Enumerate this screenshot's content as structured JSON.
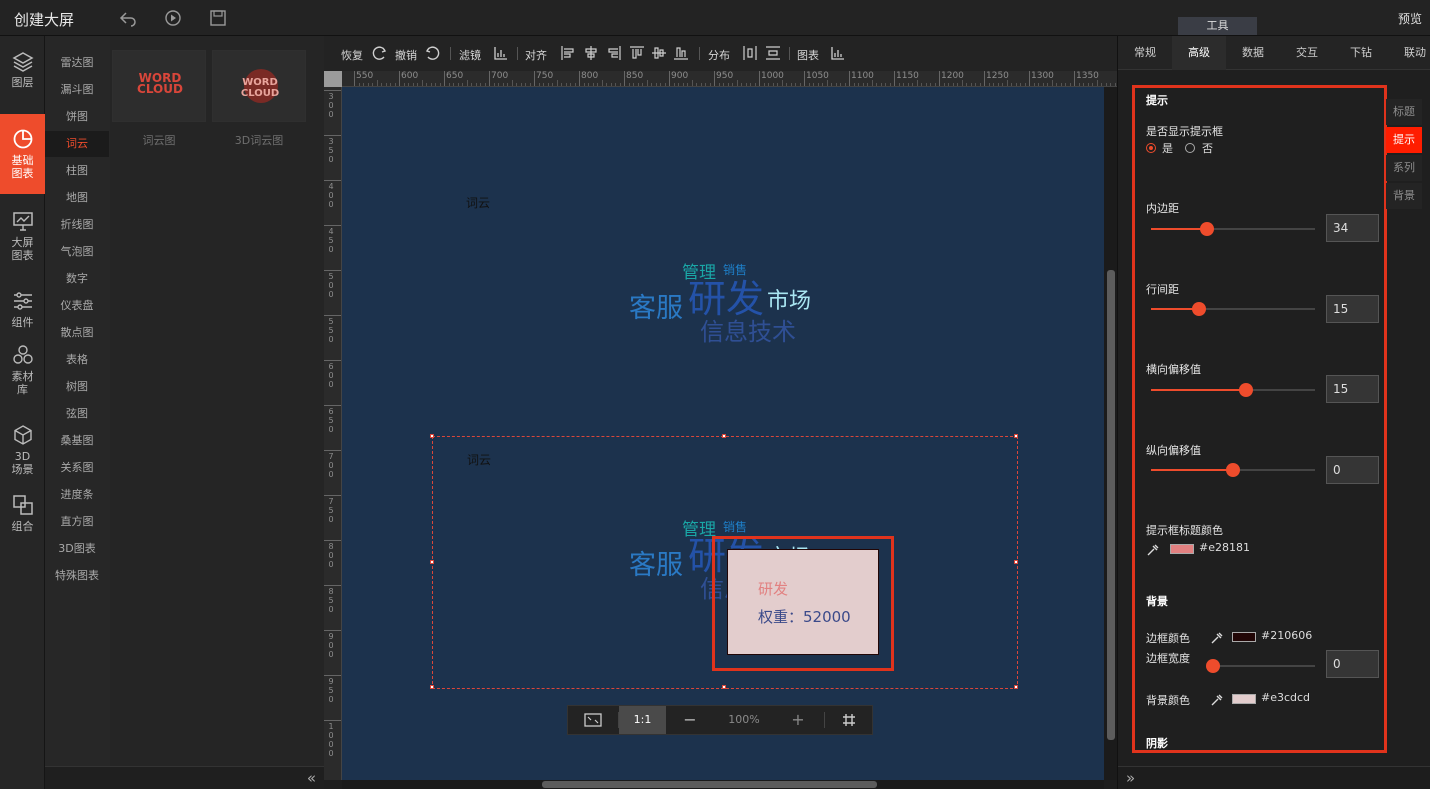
{
  "app": {
    "title": "创建大屏",
    "preview": "预览",
    "tools_tab": "工具"
  },
  "leftnav": [
    {
      "label1": "图层",
      "label2": "",
      "icon": "layers-icon"
    },
    {
      "label1": "基础",
      "label2": "图表",
      "icon": "pie-chart-icon",
      "active": true
    },
    {
      "label1": "大屏",
      "label2": "图表",
      "icon": "screen-chart-icon"
    },
    {
      "label1": "组件",
      "label2": "",
      "icon": "sliders-icon"
    },
    {
      "label1": "素材",
      "label2": "库",
      "icon": "hexagons-icon"
    },
    {
      "label1": "3D",
      "label2": "场景",
      "icon": "cube-icon"
    },
    {
      "label1": "组合",
      "label2": "",
      "icon": "group-icon"
    }
  ],
  "categories": [
    "雷达图",
    "漏斗图",
    "饼图",
    "词云",
    "柱图",
    "地图",
    "折线图",
    "气泡图",
    "数字",
    "仪表盘",
    "散点图",
    "表格",
    "树图",
    "弦图",
    "桑基图",
    "关系图",
    "进度条",
    "直方图",
    "3D图表",
    "特殊图表"
  ],
  "active_category": "词云",
  "thumbs": [
    {
      "label": "词云图",
      "logo_top": "WORD",
      "logo_bottom": "CLOUD"
    },
    {
      "label": "3D词云图",
      "logo_top": "WORD",
      "logo_bottom": "CLOUD"
    }
  ],
  "toolbar": {
    "redo": "恢复",
    "undo": "撤销",
    "filter": "滤镜",
    "align": "对齐",
    "distribute": "分布",
    "chart": "图表"
  },
  "ruler": {
    "top": [
      "550",
      "600",
      "650",
      "700",
      "750",
      "800",
      "850",
      "900",
      "950",
      "1000",
      "1050",
      "1100",
      "1150",
      "1200",
      "1250",
      "1300",
      "1350"
    ],
    "left": [
      "300",
      "350",
      "400",
      "450",
      "500",
      "550",
      "600",
      "650",
      "700",
      "750",
      "800",
      "850",
      "900",
      "950",
      "1000"
    ]
  },
  "canvas": {
    "chart1_title": "词云",
    "chart2_title": "词云",
    "words": [
      {
        "text": "管理",
        "color": "#1aa6a6"
      },
      {
        "text": "销售",
        "color": "#1e7fc8"
      },
      {
        "text": "客服",
        "color": "#2a79c4"
      },
      {
        "text": "研发",
        "color": "#2452a8"
      },
      {
        "text": "市场",
        "color": "#a9e6f2"
      },
      {
        "text": "信息技术",
        "color": "#2f4f94"
      }
    ],
    "tooltip": {
      "title": "研发",
      "body": "权重：52000"
    }
  },
  "zoom": {
    "fit": "fit-screen-icon",
    "one_to_one": "1:1",
    "minus": "−",
    "value": "100%",
    "plus": "+",
    "grid": "grid-icon"
  },
  "rpanel": {
    "tabs": [
      "常规",
      "高级",
      "数据",
      "交互",
      "下钻",
      "联动"
    ],
    "active_tab": "高级",
    "side_tabs": [
      "标题",
      "提示",
      "系列",
      "背景"
    ],
    "active_side": "提示",
    "section_tip": "提示",
    "show_tip_label": "是否显示提示框",
    "yes": "是",
    "no": "否",
    "padding_label": "内边距",
    "padding_value": "34",
    "line_gap_label": "行间距",
    "line_gap_value": "15",
    "h_offset_label": "横向偏移值",
    "h_offset_value": "15",
    "v_offset_label": "纵向偏移值",
    "v_offset_value": "0",
    "title_color_label": "提示框标题颜色",
    "title_color": "#e28181",
    "section_bg": "背景",
    "border_color_label": "边框颜色",
    "border_color": "#210606",
    "border_width_label": "边框宽度",
    "border_width_value": "0",
    "bg_color_label": "背景颜色",
    "bg_color": "#e3cdcd",
    "section_shadow": "阴影"
  },
  "sliders": {
    "padding": 0.34,
    "line_gap": 0.29,
    "h_offset": 0.58,
    "v_offset": 0.5,
    "border_width": 0.0
  }
}
